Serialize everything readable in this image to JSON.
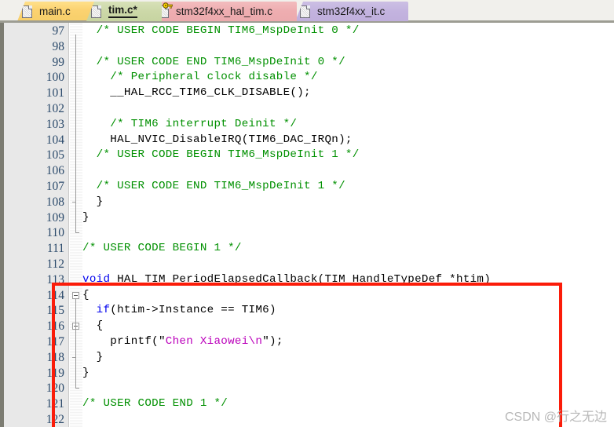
{
  "window": {
    "app": "Keil uVision Code Editor",
    "watermark": "CSDN @行之无边"
  },
  "tabs": [
    {
      "label": "main.c",
      "icon": "file-icon",
      "active": false,
      "modified": false,
      "readonly": false,
      "color": "#f7cf6a"
    },
    {
      "label": "tim.c*",
      "icon": "file-icon",
      "active": true,
      "modified": true,
      "readonly": false,
      "color": "#ccd8a8"
    },
    {
      "label": "stm32f4xx_hal_tim.c",
      "icon": "file-locked-icon",
      "active": false,
      "modified": false,
      "readonly": true,
      "color": "#eeadb0"
    },
    {
      "label": "stm32f4xx_it.c",
      "icon": "file-icon",
      "active": false,
      "modified": false,
      "readonly": false,
      "color": "#c3b3df"
    }
  ],
  "editor": {
    "first_line": 97,
    "lines": [
      {
        "n": 97,
        "tokens": [
          {
            "t": "  /* USER CODE BEGIN TIM6_MspDeInit 0 */",
            "c": "cmt"
          }
        ]
      },
      {
        "n": 98,
        "tokens": []
      },
      {
        "n": 99,
        "tokens": [
          {
            "t": "  /* USER CODE END TIM6_MspDeInit 0 */",
            "c": "cmt"
          }
        ]
      },
      {
        "n": 100,
        "tokens": [
          {
            "t": "    /* Peripheral clock disable */",
            "c": "cmt"
          }
        ]
      },
      {
        "n": 101,
        "tokens": [
          {
            "t": "    __HAL_RCC_TIM6_CLK_DISABLE();",
            "c": "pln"
          }
        ]
      },
      {
        "n": 102,
        "tokens": []
      },
      {
        "n": 103,
        "tokens": [
          {
            "t": "    /* TIM6 interrupt Deinit */",
            "c": "cmt"
          }
        ]
      },
      {
        "n": 104,
        "tokens": [
          {
            "t": "    HAL_NVIC_DisableIRQ(TIM6_DAC_IRQn);",
            "c": "pln"
          }
        ]
      },
      {
        "n": 105,
        "tokens": [
          {
            "t": "  /* USER CODE BEGIN TIM6_MspDeInit 1 */",
            "c": "cmt"
          }
        ]
      },
      {
        "n": 106,
        "tokens": []
      },
      {
        "n": 107,
        "tokens": [
          {
            "t": "  /* USER CODE END TIM6_MspDeInit 1 */",
            "c": "cmt"
          }
        ]
      },
      {
        "n": 108,
        "tokens": [
          {
            "t": "  }",
            "c": "pln"
          }
        ]
      },
      {
        "n": 109,
        "tokens": [
          {
            "t": "}",
            "c": "pln"
          }
        ]
      },
      {
        "n": 110,
        "tokens": []
      },
      {
        "n": 111,
        "tokens": [
          {
            "t": "/* USER CODE BEGIN 1 */",
            "c": "cmt"
          }
        ]
      },
      {
        "n": 112,
        "tokens": []
      },
      {
        "n": 113,
        "tokens": [
          {
            "t": "void",
            "c": "kw"
          },
          {
            "t": " HAL_TIM_PeriodElapsedCallback(TIM_HandleTypeDef *htim)",
            "c": "pln"
          }
        ]
      },
      {
        "n": 114,
        "tokens": [
          {
            "t": "{",
            "c": "pln"
          }
        ]
      },
      {
        "n": 115,
        "tokens": [
          {
            "t": "  ",
            "c": "pln"
          },
          {
            "t": "if",
            "c": "kw"
          },
          {
            "t": "(htim->Instance == TIM6)",
            "c": "pln"
          }
        ]
      },
      {
        "n": 116,
        "tokens": [
          {
            "t": "  {",
            "c": "pln"
          }
        ]
      },
      {
        "n": 117,
        "tokens": [
          {
            "t": "    printf(\"",
            "c": "pln"
          },
          {
            "t": "Chen Xiaowei\\n",
            "c": "str"
          },
          {
            "t": "\");",
            "c": "pln"
          }
        ]
      },
      {
        "n": 118,
        "tokens": [
          {
            "t": "  }",
            "c": "pln"
          }
        ]
      },
      {
        "n": 119,
        "tokens": [
          {
            "t": "}",
            "c": "pln"
          }
        ]
      },
      {
        "n": 120,
        "tokens": []
      },
      {
        "n": 121,
        "tokens": [
          {
            "t": "/* USER CODE END 1 */",
            "c": "cmt"
          }
        ]
      },
      {
        "n": 122,
        "tokens": []
      }
    ],
    "fold_markers": [
      {
        "line": 114,
        "type": "open-box"
      },
      {
        "line": 116,
        "type": "open-box"
      },
      {
        "line": 118,
        "type": "tick"
      },
      {
        "line": 120,
        "type": "end"
      },
      {
        "line": 108,
        "type": "tick"
      },
      {
        "line": 110,
        "type": "end"
      }
    ]
  },
  "annotation": {
    "shape": "rectangle",
    "color": "#fb1c09",
    "covers_lines": "112-121"
  },
  "syntax_colors": {
    "comment": "#009000",
    "keyword": "#0000ee",
    "string": "#bb00bb",
    "plain": "#000000",
    "linenumber": "#2b4a6b"
  }
}
